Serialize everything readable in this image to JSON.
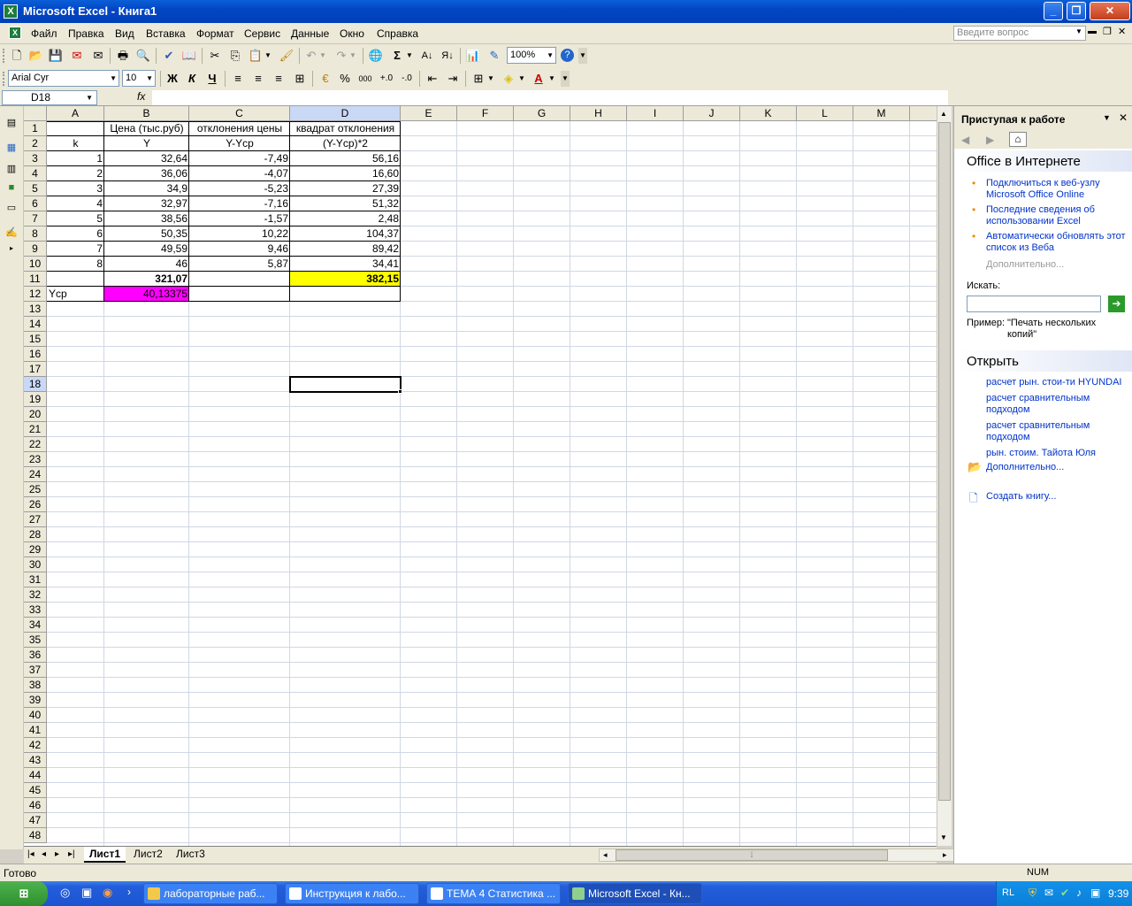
{
  "window": {
    "title": "Microsoft Excel - Книга1",
    "app_icon": "X"
  },
  "menu": {
    "items": [
      "Файл",
      "Правка",
      "Вид",
      "Вставка",
      "Формат",
      "Сервис",
      "Данные",
      "Окно",
      "Справка"
    ],
    "ask_placeholder": "Введите вопрос"
  },
  "toolbar": {
    "zoom": "100%",
    "font": "Arial Cyr",
    "size": "10",
    "sum_symbol": "Σ",
    "bold": "Ж",
    "italic": "К",
    "underline": "Ч",
    "percent": "%",
    "thousands": "000"
  },
  "formula_bar": {
    "name_box": "D18",
    "fx": "fx",
    "content": ""
  },
  "sheet": {
    "columns": [
      "A",
      "B",
      "C",
      "D",
      "E",
      "F",
      "G",
      "H",
      "I",
      "J",
      "K",
      "L",
      "M"
    ],
    "rows": [
      "1",
      "2",
      "3",
      "4",
      "5",
      "6",
      "7",
      "8",
      "9",
      "10",
      "11",
      "12",
      "13",
      "14",
      "15",
      "16",
      "17",
      "18",
      "19",
      "20",
      "21",
      "22",
      "23",
      "24",
      "25",
      "26",
      "27",
      "28",
      "29",
      "30",
      "31",
      "32",
      "33",
      "34",
      "35",
      "36",
      "37",
      "38",
      "39",
      "40",
      "41",
      "42",
      "43",
      "44",
      "45",
      "46",
      "47",
      "48"
    ],
    "cells": {
      "B1": "Цена (тыс.руб)",
      "C1": "отклонения цены",
      "D1": "квадрат отклонения",
      "A2": "k",
      "B2": "Y",
      "C2": "Y-Yср",
      "D2": "(Y-Yср)*2",
      "A3": "1",
      "B3": "32,64",
      "C3": "-7,49",
      "D3": "56,16",
      "A4": "2",
      "B4": "36,06",
      "C4": "-4,07",
      "D4": "16,60",
      "A5": "3",
      "B5": "34,9",
      "C5": "-5,23",
      "D5": "27,39",
      "A6": "4",
      "B6": "32,97",
      "C6": "-7,16",
      "D6": "51,32",
      "A7": "5",
      "B7": "38,56",
      "C7": "-1,57",
      "D7": "2,48",
      "A8": "6",
      "B8": "50,35",
      "C8": "10,22",
      "D8": "104,37",
      "A9": "7",
      "B9": "49,59",
      "C9": "9,46",
      "D9": "89,42",
      "A10": "8",
      "B10": "46",
      "C10": "5,87",
      "D10": "34,41",
      "B11": "321,07",
      "D11": "382,15",
      "A12": "Yср",
      "B12": "40,13375"
    },
    "highlight_colors": {
      "D11": "#ffff00",
      "B12": "#ff00ff"
    },
    "selected_cell": "D18",
    "tabs": [
      "Лист1",
      "Лист2",
      "Лист3"
    ],
    "active_tab": "Лист1"
  },
  "task_pane": {
    "title": "Приступая к работе",
    "section_online": "Office в Интернете",
    "online_links": [
      "Подключиться к веб-узлу Microsoft Office Online",
      "Последние сведения об использовании Excel",
      "Автоматически обновлять этот список из Веба"
    ],
    "more": "Дополнительно...",
    "search_label": "Искать:",
    "example_label": "Пример:",
    "example_text": "\"Печать нескольких копий\"",
    "section_open": "Открыть",
    "open_files": [
      "расчет рын. стои-ти HYUNDAI",
      "расчет сравнительным подходом",
      "расчет сравнительным подходом",
      "рын. стоим. Тайота Юля"
    ],
    "open_more": "Дополнительно...",
    "create": "Создать книгу..."
  },
  "status": {
    "left": "Готово",
    "num": "NUM"
  },
  "taskbar": {
    "tasks": [
      "лабораторные раб...",
      "Инструкция к лабо...",
      "ТЕМА 4 Статистика ...",
      "Microsoft Excel - Кн..."
    ],
    "lang": "RL",
    "time": "9:39"
  }
}
